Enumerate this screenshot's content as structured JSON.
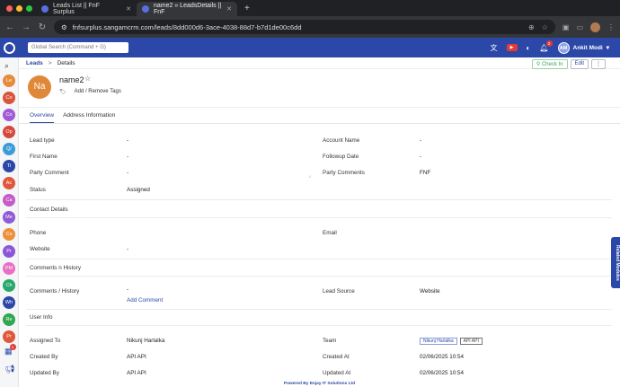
{
  "browser": {
    "tabs": [
      {
        "title": "Leads List || FnF Surplus"
      },
      {
        "title": "name2 » LeadsDetails || FnF"
      }
    ],
    "url": "fnfsurplus.sangamcrm.com/leads/8dd000d6-3ace-4038-88d7-b7d1de00c6dd"
  },
  "header": {
    "search_placeholder": "Global Search (Command + G)",
    "notification_count": "2",
    "user_initials": "AM",
    "user_name": "Ankit Modi"
  },
  "sidebar": {
    "items": [
      {
        "label": "Le",
        "color": "#e58b3a"
      },
      {
        "label": "Co",
        "color": "#d9553a"
      },
      {
        "label": "Co",
        "color": "#a15ad6"
      },
      {
        "label": "Op",
        "color": "#d4493a"
      },
      {
        "label": "Q/",
        "color": "#3b9bd8"
      },
      {
        "label": "Ti",
        "color": "#2b48a8"
      },
      {
        "label": "Ac",
        "color": "#e0573a"
      },
      {
        "label": "Ca",
        "color": "#c55ac9"
      },
      {
        "label": "Me",
        "color": "#8e5ad6"
      },
      {
        "label": "Co",
        "color": "#ee8f3a"
      },
      {
        "label": "Pr",
        "color": "#8b57d6"
      },
      {
        "label": "PM",
        "color": "#e96fc6"
      },
      {
        "label": "Ch",
        "color": "#27a86b"
      },
      {
        "label": "Wh",
        "color": "#2b48a8"
      },
      {
        "label": "Re",
        "color": "#2fa84f"
      },
      {
        "label": "Pr",
        "color": "#e0573a"
      }
    ],
    "sidebar_badge": "1"
  },
  "breadcrumb": {
    "root": "Leads",
    "separator": ">",
    "current": "Details"
  },
  "actions": {
    "check_in": "Check In",
    "edit": "Edit",
    "more": "⋮"
  },
  "entity": {
    "initials": "Na",
    "name": "name2",
    "tags_label": "Add / Remove Tags"
  },
  "tabs": [
    {
      "label": "Overview"
    },
    {
      "label": "Address Information"
    }
  ],
  "fields": {
    "lead_type_label": "Lead type",
    "lead_type": "-",
    "account_name_label": "Account Name",
    "account_name": "-",
    "first_name_label": "First Name",
    "first_name": "-",
    "followup_label": "Followup Date",
    "followup": "-",
    "party_comment_label": "Party Comment",
    "party_comment": "-",
    "party_comments_label": "Party Comments",
    "party_comments": "FNF",
    "status_label": "Status",
    "status": "Assigned"
  },
  "contact": {
    "section": "Contact Details",
    "phone_label": "Phone",
    "email_label": "Email",
    "website_label": "Website",
    "website": "-"
  },
  "comments": {
    "section": "Comments n History",
    "label": "Comments / History",
    "value": "-",
    "add_comment": "Add Comment",
    "lead_source_label": "Lead Source",
    "lead_source": "Website"
  },
  "user_info": {
    "section": "User Info",
    "assigned_to_label": "Assigned To",
    "assigned_to": "Nikunj Harlalka",
    "team_label": "Team",
    "team_1": "Nikunj Harlalka",
    "team_2": "API API",
    "created_by_label": "Created By",
    "created_by": "API API",
    "created_at_label": "Created At",
    "created_at": "02/06/2025 10:54",
    "updated_by_label": "Updated By",
    "updated_by": "API API",
    "updated_at_label": "Updated At",
    "updated_at": "02/06/2025 10:54"
  },
  "related_modules": "Related Modules",
  "footer": "Powered By Enjay IT Solutions Ltd"
}
